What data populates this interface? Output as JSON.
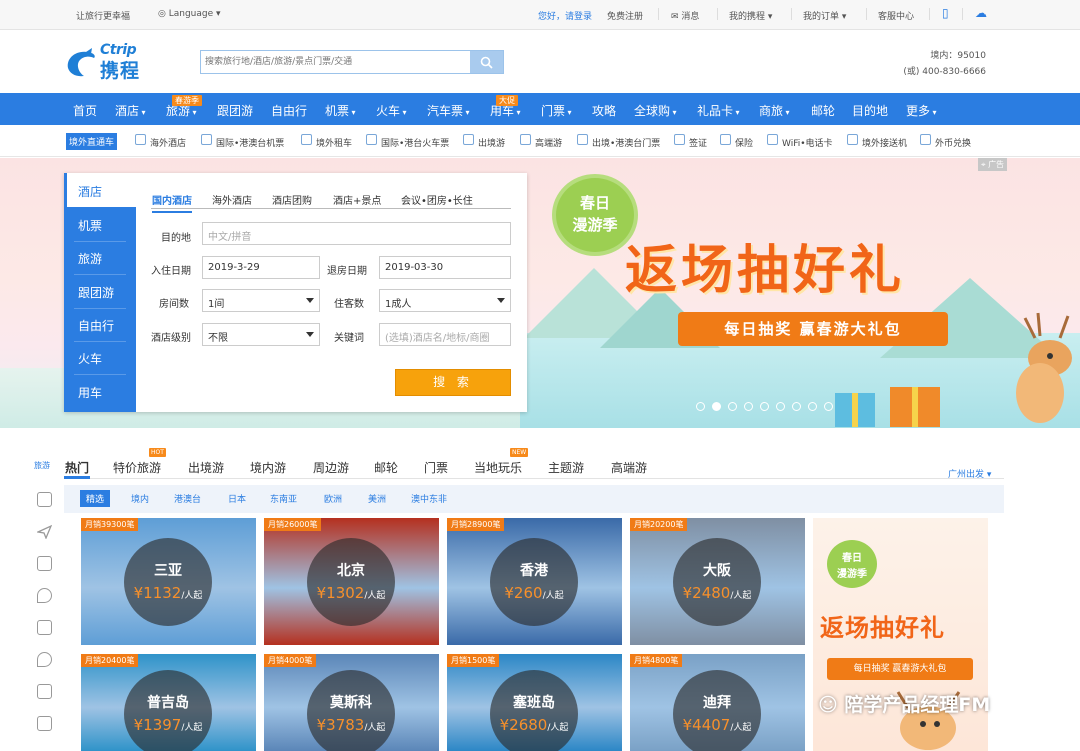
{
  "topbar": {
    "slogan": "让旅行更幸福",
    "language": "Language",
    "greeting": "您好，请登录",
    "register": "免费注册",
    "messages": "消息",
    "my_trips": "我的携程",
    "my_orders": "我的订单",
    "service": "客服中心"
  },
  "header": {
    "logo_en": "Ctrip",
    "logo_cn": "携程",
    "search_placeholder": "搜索旅行地/酒店/旅游/景点门票/交通",
    "hotline_domestic": "境内：95010",
    "hotline_overseas": "(或) 400-830-6666"
  },
  "main_nav": [
    {
      "label": "首页",
      "badge": ""
    },
    {
      "label": "酒店",
      "badge": ""
    },
    {
      "label": "旅游",
      "badge": "春游季"
    },
    {
      "label": "跟团游",
      "badge": ""
    },
    {
      "label": "自由行",
      "badge": ""
    },
    {
      "label": "机票",
      "badge": ""
    },
    {
      "label": "火车",
      "badge": ""
    },
    {
      "label": "汽车票",
      "badge": ""
    },
    {
      "label": "用车",
      "badge": "大促"
    },
    {
      "label": "门票",
      "badge": ""
    },
    {
      "label": "攻略",
      "badge": ""
    },
    {
      "label": "全球购",
      "badge": ""
    },
    {
      "label": "礼品卡",
      "badge": ""
    },
    {
      "label": "商旅",
      "badge": ""
    },
    {
      "label": "邮轮",
      "badge": ""
    },
    {
      "label": "目的地",
      "badge": ""
    },
    {
      "label": "更多",
      "badge": ""
    }
  ],
  "sub_nav": {
    "tag": "境外直通车",
    "items": [
      "海外酒店",
      "国际•港澳台机票",
      "境外租车",
      "国际•港台火车票",
      "出境游",
      "高端游",
      "出境•港澳台门票",
      "签证",
      "保险",
      "WiFi•电话卡",
      "境外接送机",
      "外币兑换"
    ]
  },
  "hero": {
    "ad_tag": "广告",
    "badge_line1": "春日",
    "badge_line2": "漫游季",
    "title": "返场抽好礼",
    "ribbon": "每日抽奖  赢春游大礼包",
    "slide_count": 9,
    "active_slide": 1
  },
  "booking": {
    "side_tabs": [
      "酒店",
      "机票",
      "旅游",
      "跟团游",
      "自由行",
      "火车",
      "用车"
    ],
    "top_tabs": [
      "国内酒店",
      "海外酒店",
      "酒店团购",
      "酒店+景点",
      "会议•团房•长住"
    ],
    "dest_label": "目的地",
    "dest_placeholder": "中文/拼音",
    "checkin_label": "入住日期",
    "checkin_value": "2019-3-29",
    "checkout_label": "退房日期",
    "checkout_value": "2019-03-30",
    "rooms_label": "房间数",
    "rooms_value": "1间",
    "guests_label": "住客数",
    "guests_value": "1成人",
    "star_label": "酒店级别",
    "star_value": "不限",
    "keyword_label": "关键词",
    "keyword_placeholder": "(选填)酒店名/地标/商圈",
    "search_btn": "搜 索"
  },
  "travel": {
    "side_label": "旅游",
    "tabs": [
      {
        "label": "热门",
        "tag": ""
      },
      {
        "label": "特价旅游",
        "tag": "HOT"
      },
      {
        "label": "出境游",
        "tag": ""
      },
      {
        "label": "境内游",
        "tag": ""
      },
      {
        "label": "周边游",
        "tag": ""
      },
      {
        "label": "邮轮",
        "tag": ""
      },
      {
        "label": "门票",
        "tag": ""
      },
      {
        "label": "当地玩乐",
        "tag": "NEW"
      },
      {
        "label": "主题游",
        "tag": ""
      },
      {
        "label": "高端游",
        "tag": ""
      }
    ],
    "departure": "广州出发",
    "filters": [
      "精选",
      "境内",
      "港澳台",
      "日本",
      "东南亚",
      "欧洲",
      "美洲",
      "澳中东非"
    ],
    "cards": [
      {
        "sales": "月销39300笔",
        "name": "三亚",
        "price": "¥1132",
        "unit": "/人起",
        "bg": "#5e9ed6"
      },
      {
        "sales": "月销26000笔",
        "name": "北京",
        "price": "¥1302",
        "unit": "/人起",
        "bg": "#b5301f"
      },
      {
        "sales": "月销28900笔",
        "name": "香港",
        "price": "¥260",
        "unit": "/人起",
        "bg": "#3a6aa8"
      },
      {
        "sales": "月销20200笔",
        "name": "大阪",
        "price": "¥2480",
        "unit": "/人起",
        "bg": "#7f8fa3"
      },
      {
        "sales": "月销20400笔",
        "name": "普吉岛",
        "price": "¥1397",
        "unit": "/人起",
        "bg": "#2f93c9"
      },
      {
        "sales": "月销4000笔",
        "name": "莫斯科",
        "price": "¥3783",
        "unit": "/人起",
        "bg": "#5b86b8"
      },
      {
        "sales": "月销1500笔",
        "name": "塞班岛",
        "price": "¥2680",
        "unit": "/人起",
        "bg": "#2c87c6"
      },
      {
        "sales": "月销4800笔",
        "name": "迪拜",
        "price": "¥4407",
        "unit": "/人起",
        "bg": "#7aa1c6"
      }
    ],
    "promo": {
      "badge_line1": "春日",
      "badge_line2": "漫游季",
      "title": "返场抽好礼",
      "ribbon": "每日抽奖 赢春游大礼包"
    }
  },
  "watermark": "陪学产品经理FM",
  "colors": {
    "brand_blue": "#2b7de1",
    "accent_orange": "#f07b16",
    "search_yellow": "#f7a20c"
  }
}
